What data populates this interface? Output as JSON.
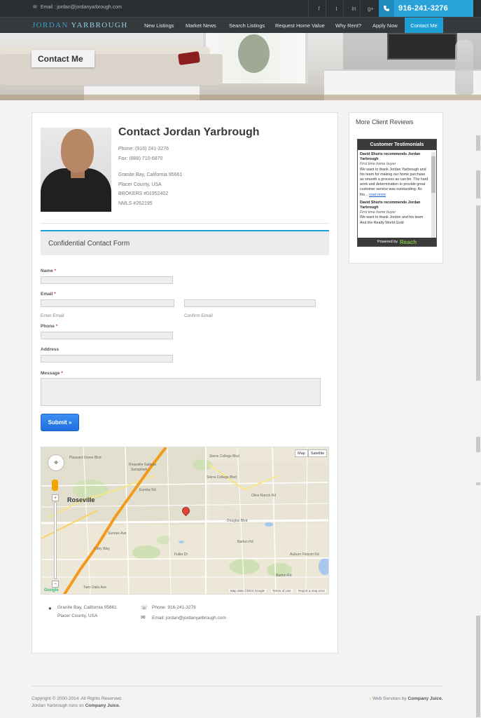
{
  "topbar": {
    "email": "Email : jordan@jordanyarbrough.com",
    "social": [
      {
        "icon": "facebook-icon",
        "glyph": "f"
      },
      {
        "icon": "twitter-icon",
        "glyph": "t"
      },
      {
        "icon": "linkedin-icon",
        "glyph": "in"
      },
      {
        "icon": "googleplus-icon",
        "glyph": "g+"
      }
    ],
    "phone": "916-241-3276"
  },
  "brand": {
    "first": "JORDAN",
    "last": "YARBROUGH"
  },
  "nav": [
    "New Listings",
    "Market News",
    "Search Listings",
    "Request Home Value",
    "Why Rent?",
    "Apply Now",
    "Contact Me"
  ],
  "hero": {
    "label": "Contact Me"
  },
  "contact": {
    "title": "Contact Jordan Yarbrough",
    "phone": "Phone: (916) 241-3276",
    "fax": "Fax: (888) 710-6870",
    "city": "Granite Bay, California 95661",
    "county": "Placer County, USA",
    "brokers": "BROKERS #01952402",
    "nmls": "NMLS #262195"
  },
  "form": {
    "heading": "Confidential Contact Form",
    "name_label": "Name",
    "email_label": "Email",
    "enter_email": "Enter Email",
    "confirm_email": "Confirm Email",
    "phone_label": "Phone",
    "address_label": "Address",
    "message_label": "Message",
    "required_mark": "*",
    "submit": "Submit »"
  },
  "map": {
    "btn_map": "Map",
    "btn_satellite": "Satellite",
    "city_label": "Roseville",
    "labels": [
      "Pleasant Grove Blvd",
      "Roseville Galleria",
      "Sunsplash",
      "Douglas Blvd",
      "Olive Ranch Rd",
      "Sierra College Blvd",
      "Eureka Rd",
      "Cirby Way",
      "Sunrise Ave",
      "Auburn Folsom Rd",
      "Barton Rd",
      "Twin Oaks Ave",
      "Sierra College Blvd",
      "Barton Rd",
      "Fuller Dr"
    ],
    "footer_data": "Map data ©2014 Google",
    "footer_terms": "Terms of Use",
    "footer_report": "Report a map error",
    "google": "Google"
  },
  "address_footer": {
    "line1": "Granite Bay, California 95661",
    "line2": "Placer County, USA",
    "phone": "Phone: 916-241-3276",
    "email": "Email: jordan@jordanyarbrough.com"
  },
  "sidebar": {
    "title": "More Client Reviews",
    "widget_title": "Customer Testimonials",
    "reviews": [
      {
        "author": "David Shurts recommends Jordan Yarbrough",
        "type": "First time home buyer",
        "text": "We want to thank Jordan Yarbrough and his team for making our home purchase as smooth a process as can be. The hard work and determination to provide great customer service was outstanding. As firs...",
        "more": "read more"
      },
      {
        "author": "David Shurts recommends Jordan Yarbrough",
        "type": "First time home buyer",
        "text": "We want to thank Jordon and his team And the Realty World Gold"
      }
    ],
    "powered_by": "Powered by",
    "powered_brand": "Reach"
  },
  "footer": {
    "copyright": "Copyright © 2000-2014. All Rights Reserved.",
    "runs_on_prefix": "Jordan Yarbrough runs on",
    "runs_on_brand": "Company Juice.",
    "web_services_prefix": "Web Services by",
    "web_services_brand": "Company Juice."
  },
  "colors": {
    "accent": "#1d9fd6",
    "topbar": "#2b2e30",
    "nav": "#35393b",
    "submit": "#2a7fe8"
  }
}
